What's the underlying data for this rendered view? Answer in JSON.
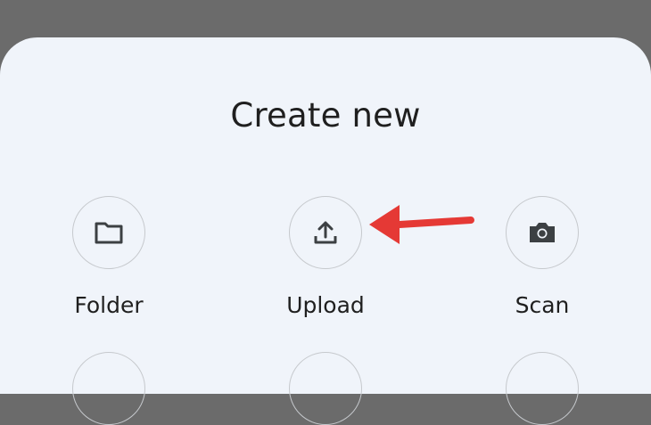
{
  "sheet": {
    "title": "Create new",
    "actions": [
      {
        "label": "Folder",
        "icon": "folder-icon"
      },
      {
        "label": "Upload",
        "icon": "upload-icon"
      },
      {
        "label": "Scan",
        "icon": "camera-icon"
      }
    ]
  },
  "annotation": {
    "arrow_color": "#e53935",
    "icon": "red-arrow-icon"
  },
  "colors": {
    "backdrop": "#6b6b6b",
    "sheet": "#f0f4fa",
    "icon": "#3c4043",
    "circle_border": "#c6c9cd"
  }
}
